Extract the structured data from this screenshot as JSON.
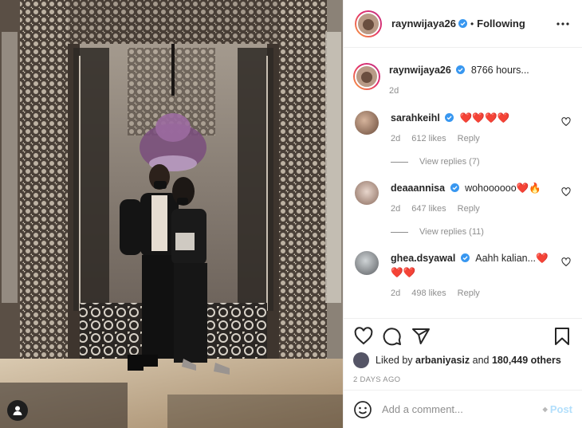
{
  "post": {
    "author": "raynwijaya26",
    "follow_state": "Following",
    "separator": "•",
    "caption": "8766 hours...",
    "caption_age": "2d"
  },
  "comments": [
    {
      "user": "sarahkeihl",
      "verified": true,
      "text": "❤️❤️❤️❤️",
      "age": "2d",
      "likes": "612 likes",
      "reply_label": "Reply",
      "view_replies": "View replies (7)"
    },
    {
      "user": "deaaannisa",
      "verified": true,
      "text": "wohoooooo❤️🔥",
      "age": "2d",
      "likes": "647 likes",
      "reply_label": "Reply",
      "view_replies": "View replies (11)"
    },
    {
      "user": "ghea.dsyawal",
      "verified": true,
      "text": "Aahh kalian...❤️❤️❤️",
      "age": "2d",
      "likes": "498 likes",
      "reply_label": "Reply"
    }
  ],
  "likes": {
    "prefix": "Liked by",
    "first_liker": "arbaniyasiz",
    "connector": "and",
    "others": "180,449 others"
  },
  "post_date": "2 DAYS AGO",
  "comment_box": {
    "placeholder": "Add a comment...",
    "post_label": "Post",
    "post_glyph": "◆"
  },
  "colors": {
    "accent_blue": "#0095f6",
    "post_disabled": "#b2dffc",
    "heart_red": "#ed1c24",
    "meta_gray": "#8e8e8e"
  },
  "icons": [
    "more-options-icon",
    "verified-icon",
    "heart-icon",
    "comment-icon",
    "share-icon",
    "bookmark-icon",
    "emoji-icon",
    "user-tag-icon"
  ]
}
